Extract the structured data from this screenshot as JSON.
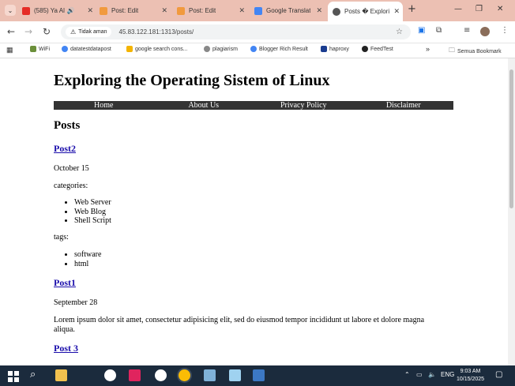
{
  "browser": {
    "tabs": [
      {
        "title": "(585) Ya Al",
        "favicon_color": "#e52d27",
        "icon": "youtube-icon"
      },
      {
        "title": "Post: Edit",
        "favicon_color": "#f19a3e",
        "icon": "blogger-icon"
      },
      {
        "title": "Post: Edit",
        "favicon_color": "#f19a3e",
        "icon": "blogger-icon"
      },
      {
        "title": "Google Translat",
        "favicon_color": "#4285f4",
        "icon": "translate-icon"
      },
      {
        "title": "Posts � Explori",
        "favicon_color": "#555555",
        "icon": "globe-icon"
      }
    ],
    "new_tab": "+",
    "security_label": "Tidak aman",
    "url": "45.83.122.181:1313/posts/",
    "bookmarks": [
      {
        "label": "WiFi",
        "color": "#6b8f3a"
      },
      {
        "label": "datatestdatapost",
        "color": "#4285f4"
      },
      {
        "label": "google search cons...",
        "color": "#f4b400"
      },
      {
        "label": "plagiarism",
        "color": "#888888"
      },
      {
        "label": "Blogger Rich Result",
        "color": "#4285f4"
      },
      {
        "label": "haproxy",
        "color": "#1a3c8f"
      },
      {
        "label": "FeedTest",
        "color": "#222222"
      }
    ],
    "bookmarks_more": "»",
    "all_bookmarks": "Semua Bookmark"
  },
  "site": {
    "title": "Exploring the Operating Sistem of Linux",
    "nav": [
      "Home",
      "About Us",
      "Privacy Policy",
      "Disclaimer"
    ],
    "heading": "Posts",
    "posts": [
      {
        "title": "Post2",
        "date": "October 15",
        "categories_label": "categories:",
        "categories": [
          "Web Server",
          "Web Blog",
          "Shell Script"
        ],
        "tags_label": "tags:",
        "tags": [
          "software",
          "html"
        ]
      },
      {
        "title": "Post1",
        "date": "September 28",
        "excerpt": "Lorem ipsum dolor sit amet, consectetur adipisicing elit, sed do eiusmod tempor incididunt ut labore et dolore magna aliqua."
      },
      {
        "title": "Post 3"
      }
    ]
  },
  "taskbar": {
    "language": "ENG",
    "time": "9:03 AM",
    "date": "10/15/2025"
  }
}
